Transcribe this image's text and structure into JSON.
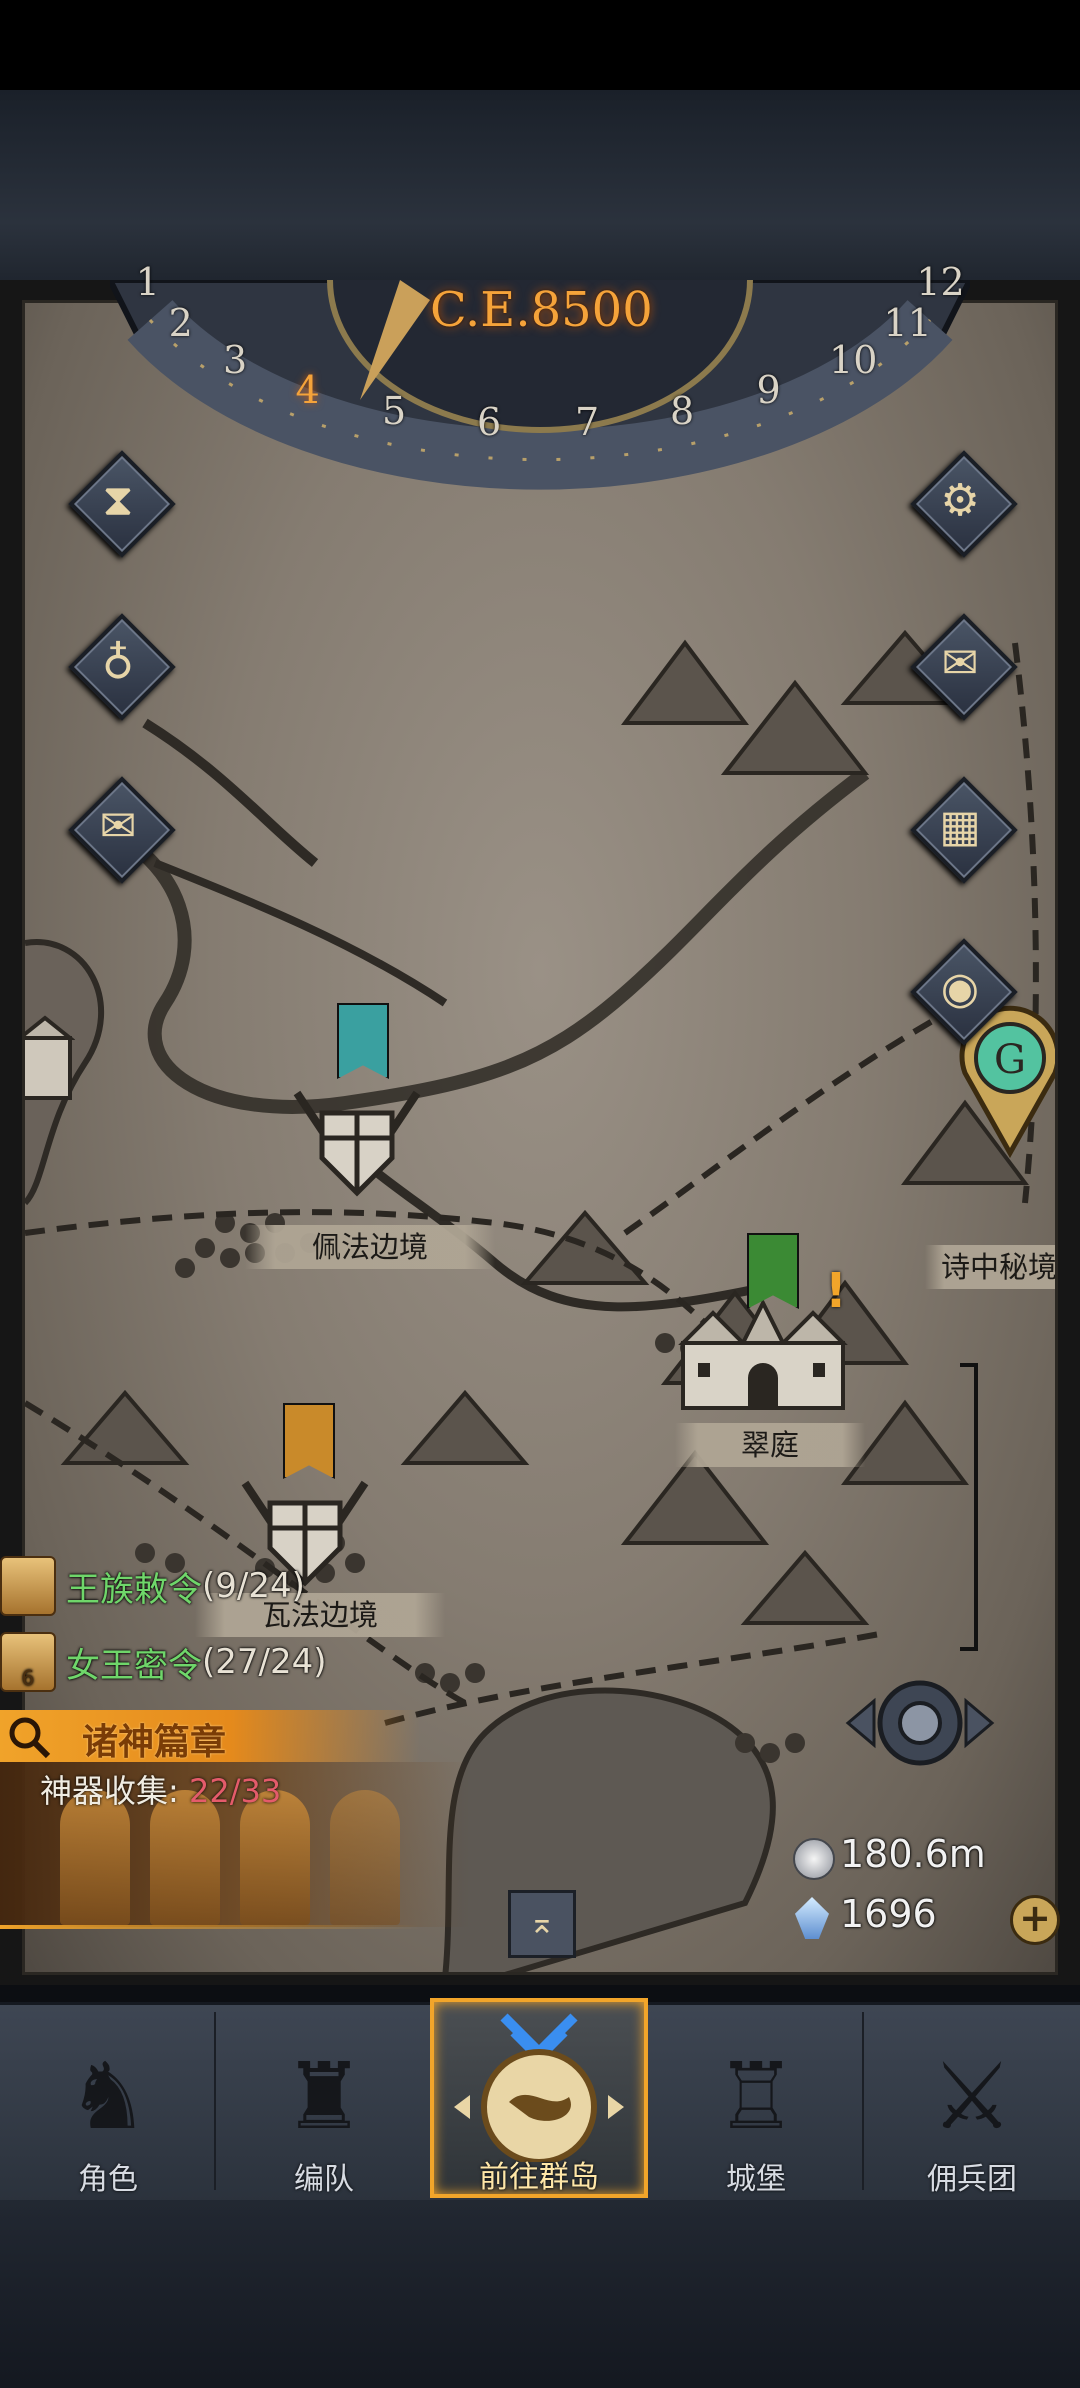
{
  "dial": {
    "year": "C.E.8500",
    "numbers": [
      "1",
      "2",
      "3",
      "4",
      "5",
      "6",
      "7",
      "8",
      "9",
      "10",
      "11",
      "12"
    ],
    "active": "4"
  },
  "side_buttons": {
    "left": [
      {
        "name": "hourglass-icon",
        "glyph": "⧗"
      },
      {
        "name": "bag-icon",
        "glyph": "♁"
      },
      {
        "name": "scroll-icon",
        "glyph": "✉"
      }
    ],
    "right": [
      {
        "name": "gear-icon",
        "glyph": "⚙"
      },
      {
        "name": "mail-icon",
        "glyph": "✉"
      },
      {
        "name": "grid-icon",
        "glyph": "▦"
      },
      {
        "name": "coin-icon",
        "glyph": "◉"
      }
    ]
  },
  "locations": {
    "peifa": "佩法边境",
    "cuiting": "翠庭",
    "wafa": "瓦法边境",
    "shizhong": "诗中秘境"
  },
  "quests": [
    {
      "label": "王族敕令",
      "count": "(9/24)",
      "badge": ""
    },
    {
      "label": "女王密令",
      "count": "(27/24)",
      "badge": "6"
    }
  ],
  "event": {
    "title": "诸神篇章",
    "sub_label": "神器收集:",
    "progress": "22/33"
  },
  "resources": {
    "silver": "180.6m",
    "crystal": "1696"
  },
  "nav": [
    {
      "label": "角色",
      "icon": "knight-icon"
    },
    {
      "label": "编队",
      "icon": "helmet-icon"
    },
    {
      "label": "前往群岛",
      "icon": "globe-icon"
    },
    {
      "label": "城堡",
      "icon": "castle-icon"
    },
    {
      "label": "佣兵团",
      "icon": "sword-banner-icon"
    }
  ],
  "colors": {
    "accent": "#f2a52a",
    "quest_green": "#6fd66a",
    "progress_red": "#e45b6b"
  }
}
